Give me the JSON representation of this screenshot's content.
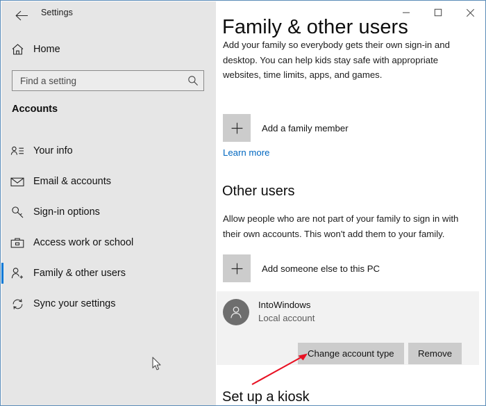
{
  "window": {
    "app_title": "Settings",
    "back_icon": "back-arrow-icon",
    "controls": {
      "minimize_label": "─",
      "maximize_label": "□",
      "close_label": "✕"
    },
    "border_color": "#5a8cb8"
  },
  "sidebar": {
    "background": "#e6e6e6",
    "accent": "#0078d7",
    "home": {
      "label": "Home",
      "icon": "home-icon"
    },
    "search": {
      "placeholder": "Find a setting",
      "value": "",
      "icon": "search-icon"
    },
    "section_header": "Accounts",
    "items": [
      {
        "label": "Your info",
        "icon": "contact-card-icon",
        "selected": false
      },
      {
        "label": "Email & accounts",
        "icon": "envelope-icon",
        "selected": false
      },
      {
        "label": "Sign-in options",
        "icon": "key-icon",
        "selected": false
      },
      {
        "label": "Access work or school",
        "icon": "briefcase-icon",
        "selected": false
      },
      {
        "label": "Family & other users",
        "icon": "add-person-icon",
        "selected": true
      },
      {
        "label": "Sync your settings",
        "icon": "sync-icon",
        "selected": false
      }
    ]
  },
  "main": {
    "page_title": "Family & other users",
    "intro_text": "Add your family so everybody gets their own sign-in and desktop. You can help kids stay safe with appropriate websites, time limits, apps, and games.",
    "add_family": {
      "label": "Add a family member",
      "icon": "plus-icon"
    },
    "learn_more": {
      "label": "Learn more",
      "color": "#0067c0"
    },
    "other_users": {
      "heading": "Other users",
      "description": "Allow people who are not part of your family to sign in with their own accounts. This won't add them to your family.",
      "add_user": {
        "label": "Add someone else to this PC",
        "icon": "plus-icon"
      },
      "account": {
        "name": "IntoWindows",
        "type": "Local account",
        "avatar_icon": "person-icon",
        "buttons": {
          "change_account_type": "Change account type",
          "remove": "Remove"
        }
      }
    },
    "kiosk": {
      "heading": "Set up a kiosk"
    }
  },
  "annotation": {
    "arrow_color": "#e81123",
    "arrow_target": "Change account type",
    "cursor_icon": "mouse-pointer-icon"
  }
}
